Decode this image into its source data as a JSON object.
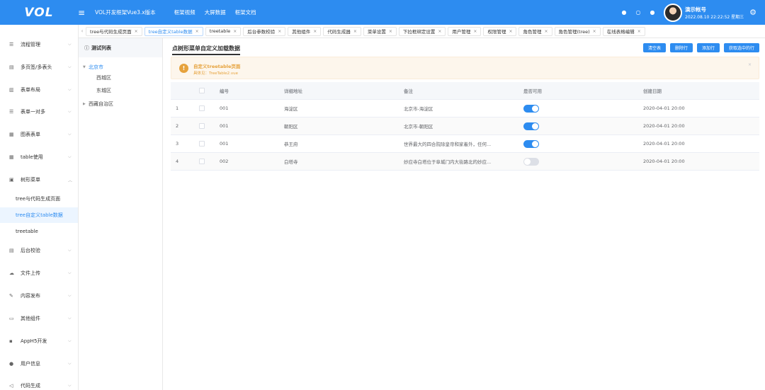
{
  "header": {
    "logo": "VOL",
    "title": "VOL开发框架Vue3.x版本",
    "links": [
      "框架视频",
      "大屏数据",
      "框架文档"
    ],
    "user_name": "演示帐号",
    "user_date": "2022.08.10 22:22:52 星期三",
    "accent": "#2d8cf0"
  },
  "sidebar": {
    "items": [
      {
        "label": "流程管理",
        "icon": "flow-icon"
      },
      {
        "label": "多页签/多表头",
        "icon": "tabs-icon"
      },
      {
        "label": "表单布局",
        "icon": "form-layout-icon"
      },
      {
        "label": "表单一对多",
        "icon": "one-to-many-icon"
      },
      {
        "label": "图表表单",
        "icon": "chart-form-icon"
      },
      {
        "label": "table使用",
        "icon": "table-icon"
      },
      {
        "label": "树形菜单",
        "icon": "tree-menu-icon"
      },
      {
        "label": "后台校验",
        "icon": "validate-icon"
      },
      {
        "label": "文件上传",
        "icon": "upload-icon"
      },
      {
        "label": "内容发布",
        "icon": "publish-icon"
      },
      {
        "label": "其他组件",
        "icon": "folder-icon"
      },
      {
        "label": "AppH5开发",
        "icon": "app-icon"
      },
      {
        "label": "用户信息",
        "icon": "user-icon"
      },
      {
        "label": "代码生成",
        "icon": "code-gen-icon"
      }
    ],
    "sub_items": [
      "tree与代码生成页面",
      "tree自定义table数据",
      "treetable"
    ]
  },
  "tabs": [
    "tree与代码生成页面",
    "tree自定义table数据",
    "treetable",
    "后台参数校验",
    "其他组件",
    "代码生成器",
    "菜单设置",
    "下拉框绑定设置",
    "用户管理",
    "权限管理",
    "角色管理",
    "角色管理(tree)",
    "在线表格编辑"
  ],
  "tree": {
    "title": "测试列表",
    "nodes": [
      "北京市",
      "西城区",
      "东城区",
      "西藏自治区"
    ]
  },
  "content": {
    "title": "点树形菜单自定义加载数据",
    "buttons": [
      "清空表",
      "删除行",
      "添加行",
      "获取选中的行"
    ],
    "alert_title": "自定义treetable页面",
    "alert_desc": "具体见：TreeTable2.vue"
  },
  "table": {
    "columns": [
      "编号",
      "详细地址",
      "备注",
      "是否可用",
      "创建日期"
    ],
    "rows": [
      {
        "idx": "1",
        "code": "001",
        "address": "海淀区",
        "note": "北京市-海淀区",
        "enabled": true,
        "date": "2020-04-01 20:00"
      },
      {
        "idx": "2",
        "code": "001",
        "address": "朝阳区",
        "note": "北京市-朝阳区",
        "enabled": true,
        "date": "2020-04-01 20:00"
      },
      {
        "idx": "3",
        "code": "001",
        "address": "恭王府",
        "note": "世界最大的四合院除皇帝和家着外，任何...",
        "enabled": true,
        "date": "2020-04-01 20:00"
      },
      {
        "idx": "4",
        "code": "002",
        "address": "白塔寺",
        "note": "妙应寺白塔位于阜城门内大街路北的妙应...",
        "enabled": false,
        "date": "2020-04-01 20:00"
      }
    ]
  }
}
